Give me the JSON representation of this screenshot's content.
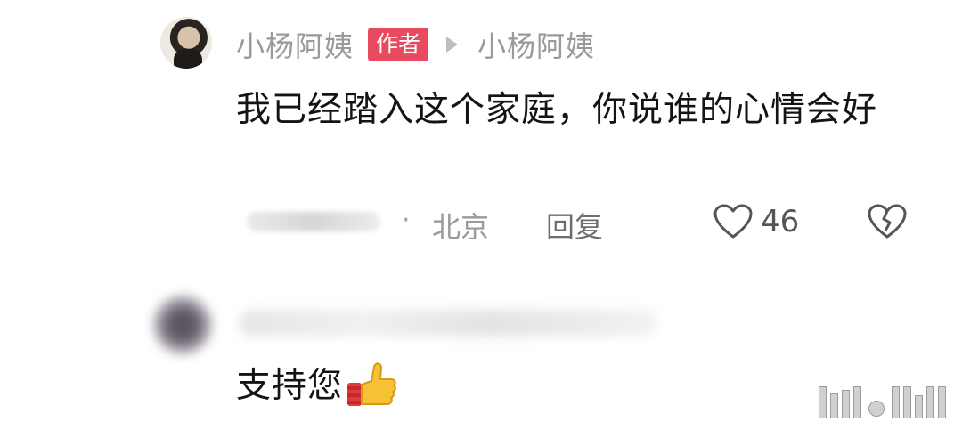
{
  "comment1": {
    "username": "小杨阿姨",
    "badge": "作者",
    "reply_to": "小杨阿姨",
    "text": "我已经踏入这个家庭，你说谁的心情会好",
    "separator": "·",
    "location": "北京",
    "reply_label": "回复",
    "like_count": "46",
    "icons": {
      "like": "heart-outline-icon",
      "dislike": "broken-heart-icon",
      "reply_arrow": "triangle-right-icon"
    }
  },
  "comment2": {
    "text": "支持您",
    "emoji": "thumbs-up-icon"
  },
  "colors": {
    "badge_bg": "#e84a5f",
    "meta_text": "#9a9a9a",
    "main_text": "#141414"
  }
}
